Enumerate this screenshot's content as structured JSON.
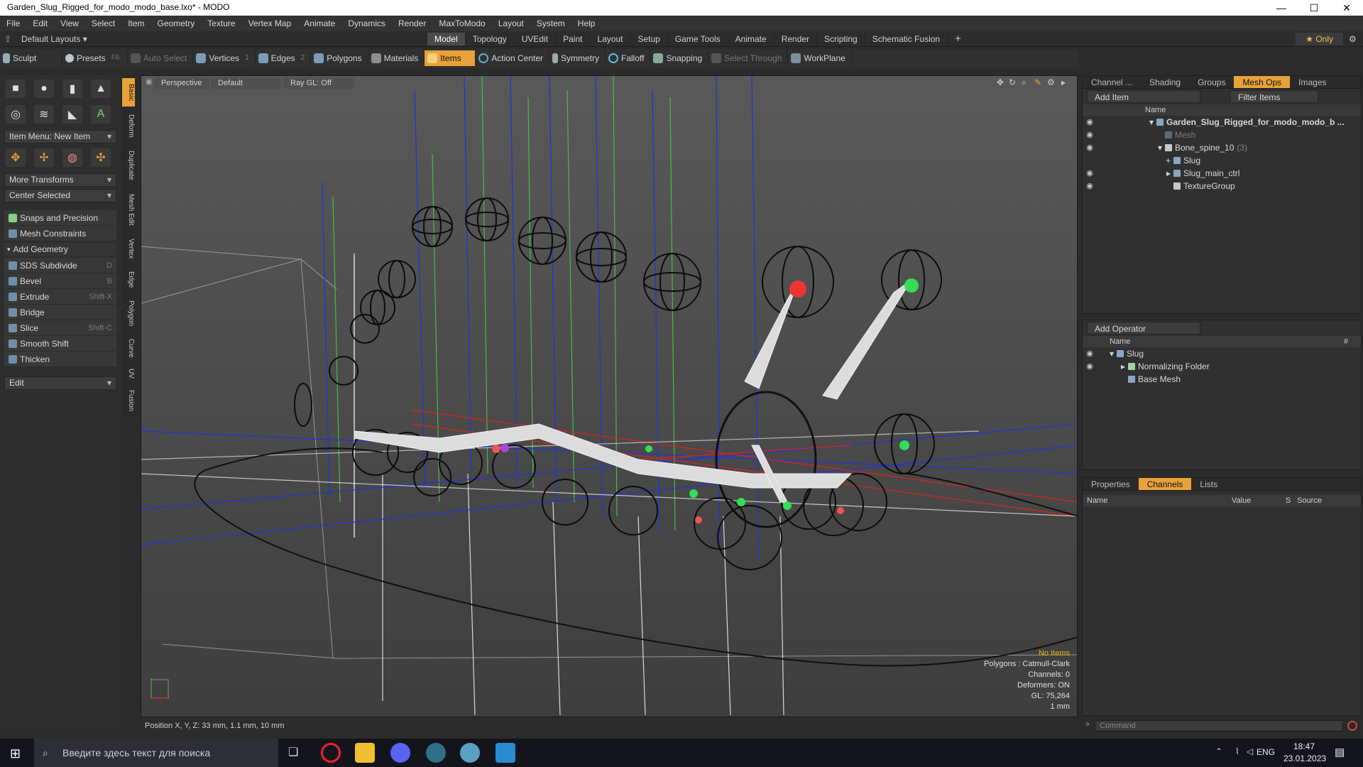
{
  "window": {
    "title": "Garden_Slug_Rigged_for_modo_modo_base.lxo* - MODO",
    "controls": [
      "—",
      "☐",
      "✕"
    ]
  },
  "menu": [
    "File",
    "Edit",
    "View",
    "Select",
    "Item",
    "Geometry",
    "Texture",
    "Vertex Map",
    "Animate",
    "Dynamics",
    "Render",
    "MaxToModo",
    "Layout",
    "System",
    "Help"
  ],
  "layoutbar": {
    "default_layouts": "Default Layouts ▾",
    "tabs": [
      "Model",
      "Topology",
      "UVEdit",
      "Paint",
      "Layout",
      "Setup",
      "Game Tools",
      "Animate",
      "Render",
      "Scripting",
      "Schematic Fusion"
    ],
    "active_tab": "Model",
    "add": "+",
    "only": "★  Only"
  },
  "toolbar": {
    "sculpt": "Sculpt",
    "presets": "Presets",
    "presets_key": "F6",
    "auto_select": "Auto Select",
    "vertices": "Vertices",
    "vertices_count": "1",
    "edges": "Edges",
    "edges_count": "2",
    "polygons": "Polygons",
    "materials": "Materials",
    "items": "Items",
    "action_center": "Action Center",
    "symmetry": "Symmetry",
    "falloff": "Falloff",
    "snapping": "Snapping",
    "select_through": "Select Through",
    "workplane": "WorkPlane"
  },
  "leftpanel": {
    "item_menu": "Item Menu: New Item",
    "more_transforms": "More Transforms",
    "center_selected": "Center Selected",
    "snaps": "Snaps and Precision",
    "mesh_constraints": "Mesh Constraints",
    "add_geometry": "Add Geometry",
    "commands": [
      {
        "label": "SDS Subdivide",
        "key": "D"
      },
      {
        "label": "Bevel",
        "key": "B"
      },
      {
        "label": "Extrude",
        "key": "Shift-X"
      },
      {
        "label": "Bridge",
        "key": ""
      },
      {
        "label": "Slice",
        "key": "Shift-C"
      },
      {
        "label": "Smooth Shift",
        "key": ""
      },
      {
        "label": "Thicken",
        "key": ""
      }
    ],
    "edit": "Edit"
  },
  "vtabs": [
    "Basic",
    "Deform",
    "Duplicate",
    "Mesh Edit",
    "Vertex",
    "Edge",
    "Polygon",
    "Curve",
    "UV",
    "Fusion"
  ],
  "viewport": {
    "view": "Perspective",
    "shading": "Default",
    "raygl": "Ray GL: Off",
    "info": {
      "no_items": "No Items",
      "polygons": "Polygons : Catmull-Clark",
      "channels": "Channels: 0",
      "deformers": "Deformers: ON",
      "gl": "GL: 75,264",
      "unit": "1 mm"
    }
  },
  "status": "Position X, Y, Z:  33 mm, 1.1 mm, 10 mm",
  "items_panel": {
    "tabs": [
      "Channel ...",
      "Shading",
      "Groups",
      "Mesh Ops",
      "Images"
    ],
    "active": "Mesh Ops",
    "add_item": "Add Item",
    "filter": "Filter Items",
    "col_name": "Name",
    "rows": [
      {
        "label": "Garden_Slug_Rigged_for_modo_modo_b ...",
        "bold": true,
        "dim": false
      },
      {
        "label": "Mesh",
        "bold": false,
        "dim": true
      },
      {
        "label": "Bone_spine_10",
        "extra": "(3)",
        "bold": false,
        "dim": false
      },
      {
        "label": "Slug",
        "bold": false,
        "dim": false
      },
      {
        "label": "Slug_main_ctrl",
        "bold": false,
        "dim": false
      },
      {
        "label": "TextureGroup",
        "bold": false,
        "dim": false
      }
    ]
  },
  "operator_panel": {
    "add_operator": "Add Operator",
    "col_name": "Name",
    "col_hash": "#",
    "rows": [
      "Slug",
      "Normalizing Folder",
      "Base Mesh"
    ]
  },
  "props_panel": {
    "tabs": [
      "Properties",
      "Channels",
      "Lists"
    ],
    "active": "Channels",
    "cols": [
      "Name",
      "Value",
      "S",
      "Source"
    ]
  },
  "command": "Command",
  "taskbar": {
    "search": "Введите здесь текст для поиска",
    "lang": "ENG",
    "time": "18:47",
    "date": "23.01.2023"
  }
}
